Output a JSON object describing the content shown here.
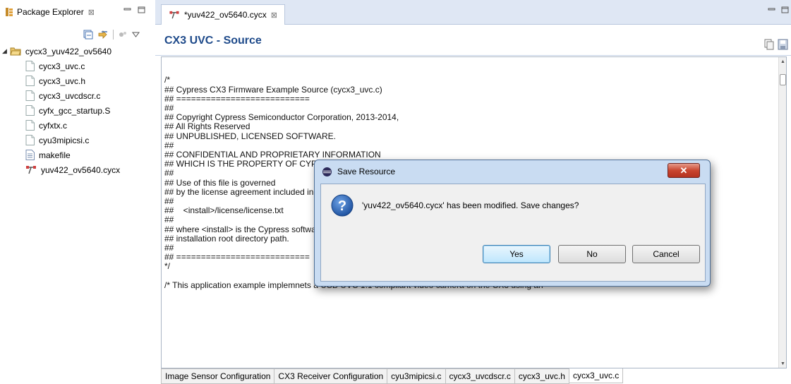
{
  "package_explorer": {
    "tab_label": "Package Explorer",
    "close_glyph": "⊠",
    "tree": {
      "project": "cycx3_yuv422_ov5640",
      "files": [
        {
          "name": "cycx3_uvc.c",
          "icon": "c-file-icon"
        },
        {
          "name": "cycx3_uvc.h",
          "icon": "h-file-icon"
        },
        {
          "name": "cycx3_uvcdscr.c",
          "icon": "c-file-icon"
        },
        {
          "name": "cyfx_gcc_startup.S",
          "icon": "s-file-icon"
        },
        {
          "name": "cyfxtx.c",
          "icon": "c-file-icon"
        },
        {
          "name": "cyu3mipicsi.c",
          "icon": "c-file-icon"
        },
        {
          "name": "makefile",
          "icon": "makefile-icon"
        },
        {
          "name": "yuv422_ov5640.cycx",
          "icon": "cycx-config-icon"
        }
      ]
    }
  },
  "editor": {
    "tab_label": "*yuv422_ov5640.cycx",
    "close_glyph": "⊠",
    "title": "CX3 UVC - Source",
    "title_color": "#1e4a8a",
    "code": "\n\n/*\n## Cypress CX3 Firmware Example Source (cycx3_uvc.c)\n## ===========================\n##\n## Copyright Cypress Semiconductor Corporation, 2013-2014,\n## All Rights Reserved\n## UNPUBLISHED, LICENSED SOFTWARE.\n##\n## CONFIDENTIAL AND PROPRIETARY INFORMATION\n## WHICH IS THE PROPERTY OF CYPRESS.\n##\n## Use of this file is governed\n## by the license agreement included in the file\n##\n##    <install>/license/license.txt\n##\n## where <install> is the Cypress software\n## installation root directory path.\n##\n## ===========================\n*/\n\n/* This application example implemnets a USB UVC 1.1 compliant video camera on the CX3 using an",
    "bottom_tabs": [
      "Image Sensor Configuration",
      "CX3 Receiver Configuration",
      "cyu3mipicsi.c",
      "cycx3_uvcdscr.c",
      "cycx3_uvc.h",
      "cycx3_uvc.c"
    ],
    "active_bottom_tab": "cycx3_uvc.c"
  },
  "dialog": {
    "title": "Save Resource",
    "message": "'yuv422_ov5640.cycx' has been modified. Save changes?",
    "icon": "question-icon",
    "buttons": {
      "yes": "Yes",
      "no": "No",
      "cancel": "Cancel"
    },
    "default_button": "Yes"
  }
}
